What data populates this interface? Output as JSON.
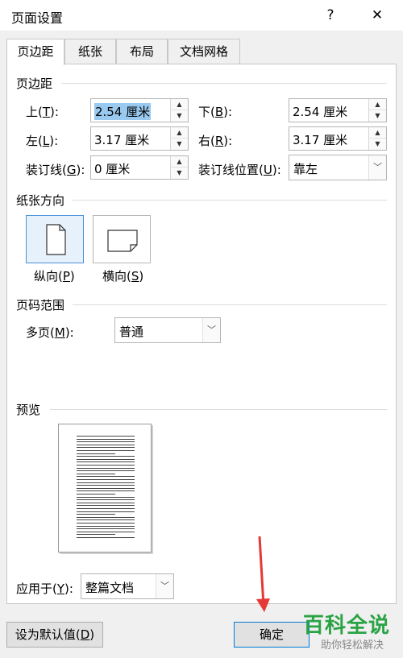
{
  "window": {
    "title": "页面设置",
    "help_glyph": "?",
    "close_glyph": "✕"
  },
  "tabs": [
    {
      "label": "页边距"
    },
    {
      "label": "纸张"
    },
    {
      "label": "布局"
    },
    {
      "label": "文档网格"
    }
  ],
  "margins": {
    "group_title": "页边距",
    "top": {
      "label": "上(",
      "key": "T",
      "suffix": "):",
      "value": "2.54 厘米"
    },
    "bottom": {
      "label": "下(",
      "key": "B",
      "suffix": "):",
      "value": "2.54 厘米"
    },
    "left": {
      "label": "左(",
      "key": "L",
      "suffix": "):",
      "value": "3.17 厘米"
    },
    "right": {
      "label": "右(",
      "key": "R",
      "suffix": "):",
      "value": "3.17 厘米"
    },
    "gutter": {
      "label": "装订线(",
      "key": "G",
      "suffix": "):",
      "value": "0 厘米"
    },
    "gutter_pos": {
      "label": "装订线位置(",
      "key": "U",
      "suffix": "):",
      "value": "靠左"
    }
  },
  "orientation": {
    "group_title": "纸张方向",
    "portrait": {
      "label": "纵向(",
      "key": "P",
      "suffix": ")"
    },
    "landscape": {
      "label": "横向(",
      "key": "S",
      "suffix": ")"
    }
  },
  "pages": {
    "group_title": "页码范围",
    "multiple": {
      "label": "多页(",
      "key": "M",
      "suffix": "):",
      "value": "普通"
    }
  },
  "preview": {
    "group_title": "预览"
  },
  "apply": {
    "label": "应用于(",
    "key": "Y",
    "suffix": "):",
    "value": "整篇文档"
  },
  "buttons": {
    "default": {
      "label": "设为默认值(",
      "key": "D",
      "suffix": ")"
    },
    "ok": "确定"
  },
  "watermark": {
    "main": "百科全说",
    "sub": "助你轻松解决"
  },
  "colors": {
    "accent": "#0078d7",
    "selection": "#99c9ef",
    "watermark": "#2aa345",
    "annotation": "#e53935"
  }
}
